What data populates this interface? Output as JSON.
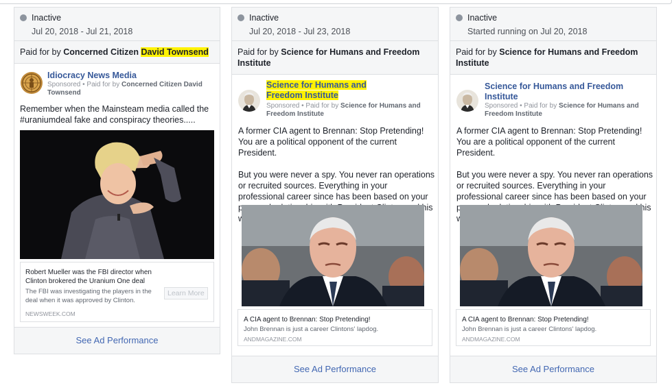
{
  "cards": [
    {
      "status": "Inactive",
      "date": "Jul 20, 2018 - Jul 21, 2018",
      "paid_prefix": "Paid for by ",
      "paid_name_plain": "Concerned Citizen ",
      "paid_name_highlight": "David Townsend",
      "page_name": "Idiocracy News Media",
      "sponsored_prefix": "Sponsored • Paid for by ",
      "sponsored_name": "Concerned Citizen David Townsend",
      "body": "Remember when the Mainsteam media called the #uraniumdeal fake and conspiracy theories.....",
      "link_title": "Robert Mueller was the FBI director when Clinton brokered the Uranium One deal",
      "link_desc": "The FBI was investigating the players in the deal when it was approved by Clinton.",
      "link_domain": "NEWSWEEK.COM",
      "learn_more": "Learn More",
      "perf": "See Ad Performance"
    },
    {
      "status": "Inactive",
      "date": "Jul 20, 2018 - Jul 23, 2018",
      "paid_prefix": "Paid for by ",
      "paid_name": "Science for Humans and Freedom Institute",
      "page_name": "Science for Humans and Freedom Institute",
      "sponsored_prefix": "Sponsored • Paid for by ",
      "sponsored_name": "Science for Humans and Freedom Institute",
      "body1": "A former CIA agent to Brennan: Stop Pretending! You are a political opponent of the current President.",
      "body2": "But you were never a spy. You never ran operations or recruited sources. Everything in your professional career since has been based on your personal relationship with President Clinton and his wife…",
      "link_title": "A CIA agent to Brennan: Stop Pretending!",
      "link_desc": "John Brennan is just a career Clintons' lapdog.",
      "link_domain": "ANDMAGAZINE.COM",
      "perf": "See Ad Performance"
    },
    {
      "status": "Inactive",
      "date": "Started running on Jul 20, 2018",
      "paid_prefix": "Paid for by ",
      "paid_name": "Science for Humans and Freedom Institute",
      "page_name": "Science for Humans and Freedom Institute",
      "sponsored_prefix": "Sponsored • Paid for by ",
      "sponsored_name": "Science for Humans and Freedom Institute",
      "body1": "A former CIA agent to Brennan: Stop Pretending! You are a political opponent of the current President.",
      "body2": "But you were never a spy. You never ran operations or recruited sources. Everything in your professional career since has been based on your personal relationship with President Clinton and his wife…",
      "link_title": "A CIA agent to Brennan: Stop Pretending!",
      "link_desc": "John Brennan is just a career Clintons' lapdog.",
      "link_domain": "ANDMAGAZINE.COM",
      "perf": "See Ad Performance"
    }
  ],
  "colors": {
    "highlight": "#fff200",
    "link_blue": "#365899",
    "perf_blue": "#4267b2",
    "status_dot": "#8d949e"
  }
}
